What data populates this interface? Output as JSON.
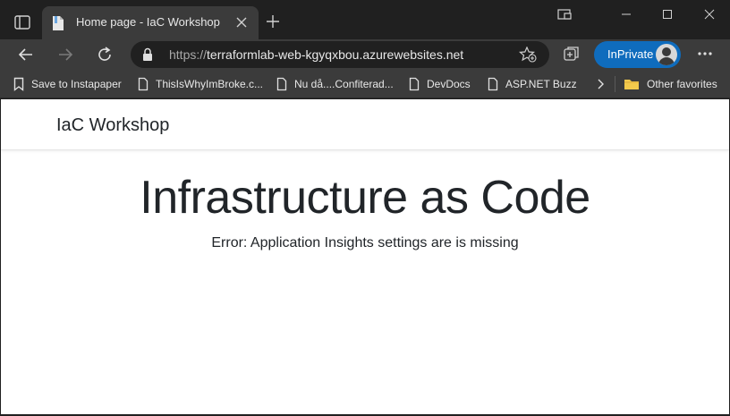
{
  "tab": {
    "title": "Home page - IaC Workshop"
  },
  "address": {
    "scheme": "https://",
    "host": "terraformlab-web-kgyqxbou.azurewebsites.net"
  },
  "inprivate": {
    "label": "InPrivate"
  },
  "bookmarks": [
    {
      "label": "Save to Instapaper",
      "icon": "bookmark-icon"
    },
    {
      "label": "ThisIsWhyImBroke.c...",
      "icon": "page-icon"
    },
    {
      "label": "Nu då....Confiterad...",
      "icon": "page-icon"
    },
    {
      "label": "DevDocs",
      "icon": "page-icon"
    },
    {
      "label": "ASP.NET Buzz",
      "icon": "page-icon"
    }
  ],
  "other_favorites": {
    "label": "Other favorites",
    "icon": "folder-icon"
  },
  "page": {
    "brand": "IaC Workshop",
    "heading": "Infrastructure as Code",
    "error": "Error: Application Insights settings are is missing"
  },
  "colors": {
    "chrome_dark": "#202020",
    "chrome_mid": "#3b3b3b",
    "accent": "#0f6cbd",
    "folder": "#f2c94c"
  }
}
